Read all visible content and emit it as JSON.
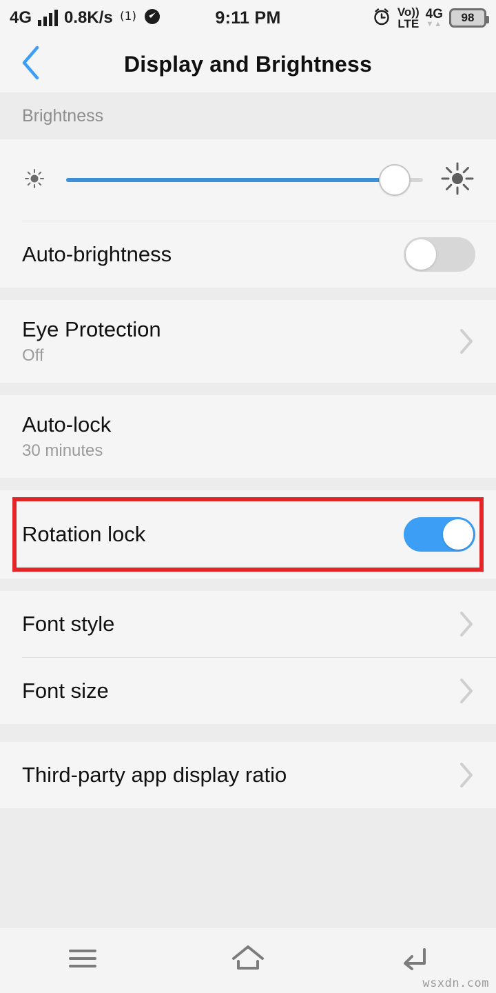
{
  "status_bar": {
    "network_label": "4G",
    "data_speed": "0.8K/s",
    "hotspot_icon": "hotspot-icon",
    "signal_bars_icon": "signal-bars-icon",
    "compass_icon": "compass-icon",
    "time": "9:11 PM",
    "alarm_icon": "alarm-clock-icon",
    "volte_top": "Vo))",
    "volte_bottom": "LTE",
    "network_right_label": "4G",
    "data_arrows": "▼▲",
    "battery_percent": "98"
  },
  "titlebar": {
    "back_icon": "back-chevron-icon",
    "title": "Display and Brightness"
  },
  "sections": {
    "brightness_header": "Brightness",
    "brightness_slider": {
      "low_icon": "sun-low-icon",
      "high_icon": "sun-high-icon",
      "value_percent": 92,
      "fill_color": "#3d8fd6"
    },
    "auto_brightness": {
      "label": "Auto-brightness",
      "toggle_state": "off"
    },
    "eye_protection": {
      "label": "Eye Protection",
      "value": "Off",
      "chevron_icon": "chevron-right-icon"
    },
    "auto_lock": {
      "label": "Auto-lock",
      "value": "30 minutes"
    },
    "rotation_lock": {
      "label": "Rotation lock",
      "toggle_state": "on",
      "highlight_color": "#e22526"
    },
    "font_style": {
      "label": "Font style",
      "chevron_icon": "chevron-right-icon"
    },
    "font_size": {
      "label": "Font size",
      "chevron_icon": "chevron-right-icon"
    },
    "third_party_ratio": {
      "label": "Third-party app display ratio",
      "chevron_icon": "chevron-right-icon"
    }
  },
  "navbar": {
    "menu_icon": "menu-icon",
    "home_icon": "home-icon",
    "back_icon": "back-arrow-icon"
  },
  "watermark": "wsxdn.com"
}
